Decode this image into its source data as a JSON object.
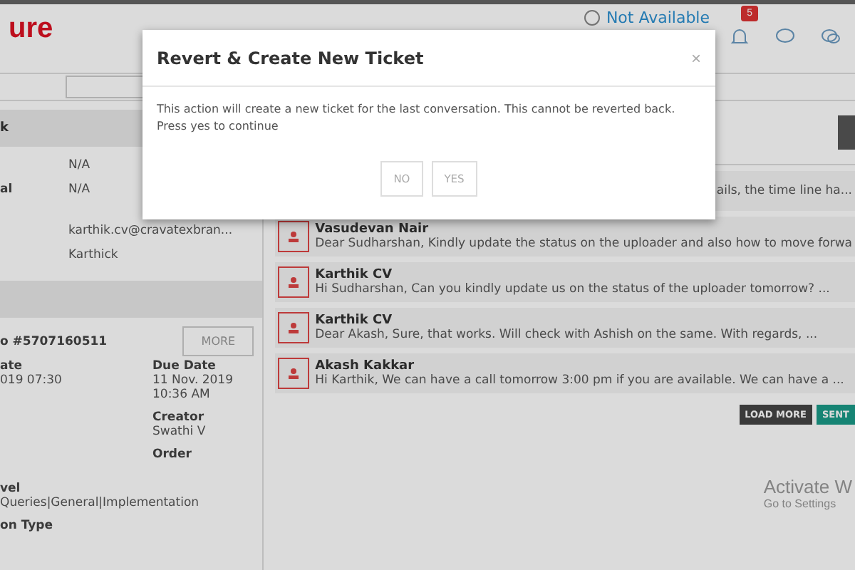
{
  "header": {
    "logo": "ure",
    "status": {
      "label": "Not Available",
      "selected": false
    },
    "notifications": {
      "count": "5"
    }
  },
  "left_panel": {
    "contact_title": "k",
    "contact_fields": [
      {
        "value": "N/A"
      },
      {
        "label": "al",
        "value": "N/A"
      },
      {
        "value": "karthik.cv@cravatexbran..."
      },
      {
        "value": "Karthick"
      }
    ],
    "ticket_id": "o #5707160511",
    "more_button": "MORE",
    "ticket_columns": [
      [
        {
          "label": "ate",
          "value": "019 07:30"
        }
      ],
      [
        {
          "label": "Due Date",
          "value": "11 Nov. 2019 10:36 AM"
        },
        {
          "label": "Creator",
          "value": "Swathi V"
        },
        {
          "label": "Order"
        }
      ]
    ],
    "level": {
      "label": "vel",
      "value": "Queries|General|Implementation"
    },
    "type_label": "on Type"
  },
  "conversations": [
    {
      "snippet": "ails, the time line ha..."
    },
    {
      "name": "Vasudevan Nair",
      "snippet": "Dear Sudharshan,  Kindly update the status on the uploader and also how to move forwa"
    },
    {
      "name": "Karthik CV",
      "snippet": "Hi Sudharshan, Can you kindly update us on the status of the uploader tomorrow? ..."
    },
    {
      "name": "Karthik CV",
      "snippet": "Dear Akash, Sure, that works. Will check with Ashish on the same. With regards, ..."
    },
    {
      "name": "Akash Kakkar",
      "snippet": "Hi Karthik, We can have a call tomorrow 3:00 pm if you are available. We can have a ..."
    }
  ],
  "actions": [
    "LOAD MORE",
    "SENT"
  ],
  "os_notice": {
    "title": "Activate W",
    "subtitle": "Go to Settings"
  },
  "dialog": {
    "title": "Revert & Create New Ticket",
    "close": "×",
    "message": "This action will create a new ticket for the last conversation. This cannot be reverted back.\nPress yes to continue",
    "buttons": [
      "NO",
      "YES"
    ]
  }
}
